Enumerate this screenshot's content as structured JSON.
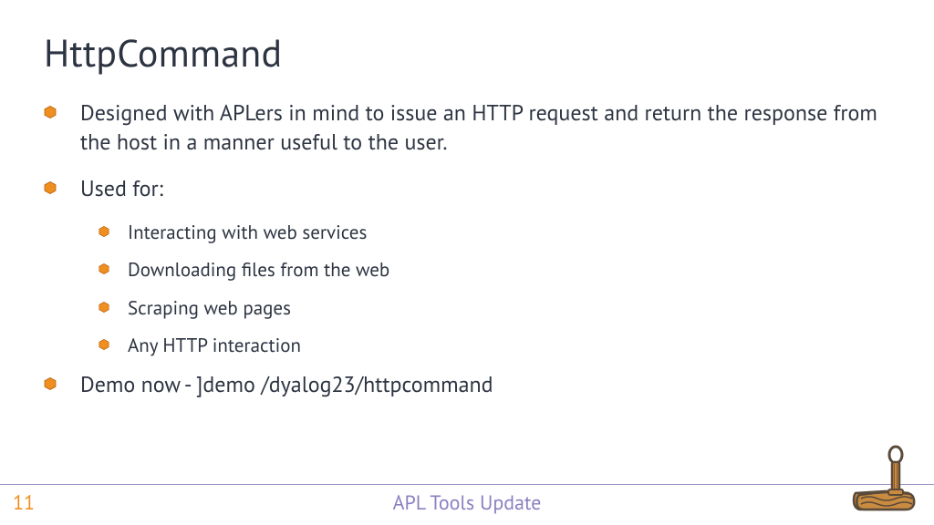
{
  "title": "HttpCommand",
  "bullets": {
    "b0": "Designed with APLers in mind to issue an HTTP request and return the response from the host in a manner useful to the user.",
    "b1": "Used for:",
    "sub": {
      "s0": "Interacting with web services",
      "s1": "Downloading files from the web",
      "s2": "Scraping web pages",
      "s3": "Any HTTP interaction"
    },
    "b2": "Demo now - ]demo /dyalog23/httpcommand"
  },
  "footer": {
    "page": "11",
    "title": "APL Tools Update"
  },
  "colors": {
    "bullet": "#ef8f1f",
    "bullet_stroke": "#b65f0c",
    "title": "#2d3441",
    "footer_accent": "#8c7fc1"
  }
}
